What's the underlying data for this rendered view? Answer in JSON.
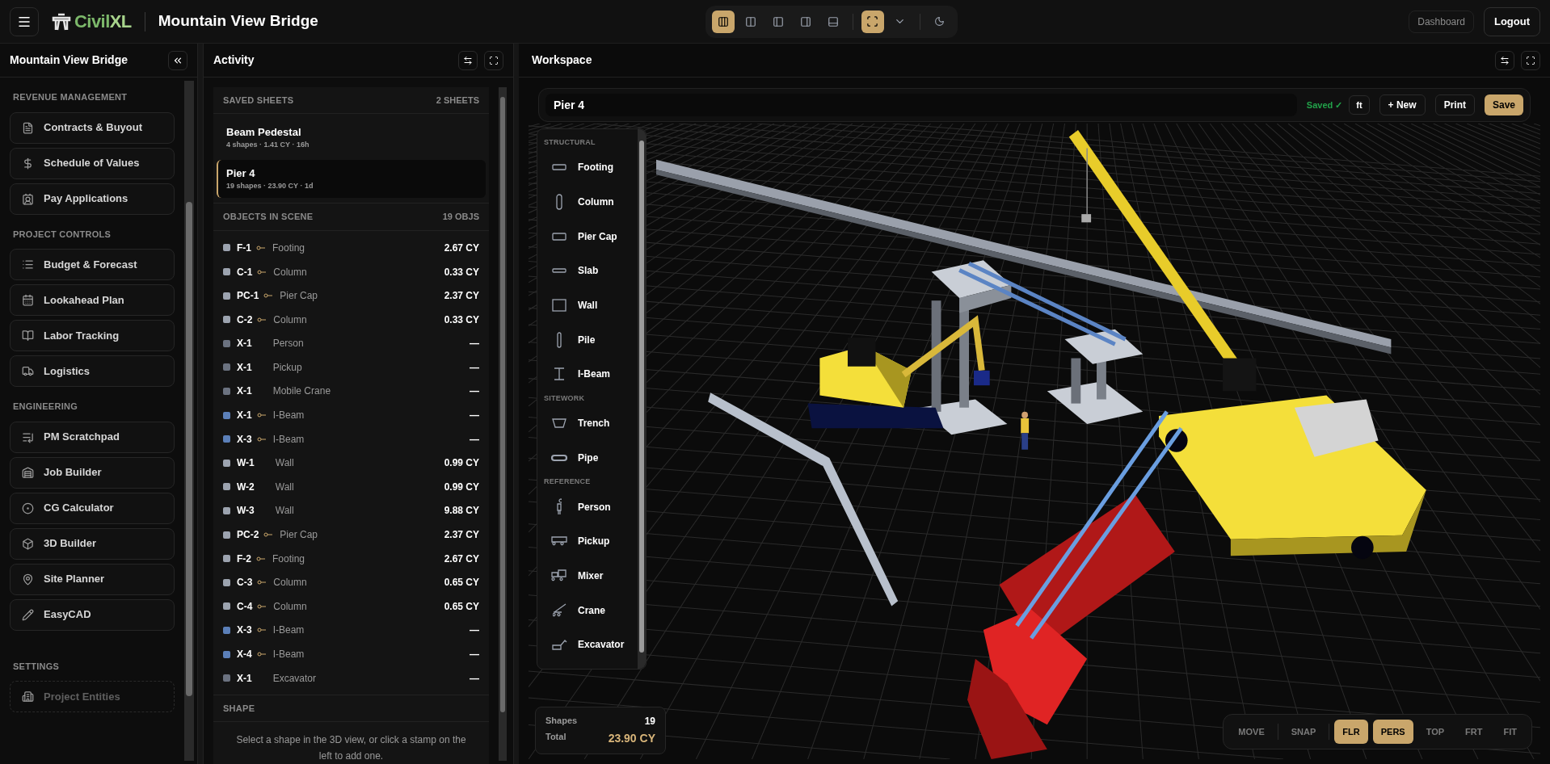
{
  "header": {
    "project_title": "Mountain View Bridge",
    "logo": {
      "prefix": "Civil",
      "suffix": "XL"
    },
    "view_buttons": [
      {
        "selected": true
      },
      {
        "selected": false
      },
      {
        "selected": false
      },
      {
        "selected": false
      },
      {
        "selected": false
      }
    ],
    "fullscreen": {
      "selected": true
    },
    "actions": [
      {
        "label": "Dashboard",
        "kind": "ghost"
      },
      {
        "label": "Logout",
        "kind": "outline"
      }
    ]
  },
  "sidebar": {
    "title": "Mountain View Bridge",
    "sections": [
      {
        "label": "REVENUE MANAGEMENT",
        "items": [
          {
            "label": "Contracts & Buyout",
            "disabled": false
          },
          {
            "label": "Schedule of Values",
            "disabled": false
          },
          {
            "label": "Pay Applications",
            "disabled": false
          }
        ]
      },
      {
        "label": "PROJECT CONTROLS",
        "items": [
          {
            "label": "Budget & Forecast",
            "disabled": false
          },
          {
            "label": "Lookahead Plan",
            "disabled": false
          },
          {
            "label": "Labor Tracking",
            "disabled": false
          },
          {
            "label": "Logistics",
            "disabled": false
          }
        ]
      },
      {
        "label": "ENGINEERING",
        "items": [
          {
            "label": "PM Scratchpad",
            "disabled": false
          },
          {
            "label": "Job Builder",
            "disabled": false
          },
          {
            "label": "CG Calculator",
            "disabled": false
          },
          {
            "label": "3D Builder",
            "disabled": false
          },
          {
            "label": "Site Planner",
            "disabled": false
          },
          {
            "label": "EasyCAD",
            "disabled": false
          }
        ]
      },
      {
        "label": "SETTINGS",
        "items": [
          {
            "label": "Project Entities",
            "disabled": true
          }
        ]
      }
    ]
  },
  "activity": {
    "title": "Activity",
    "saved_sheets": {
      "label": "SAVED SHEETS",
      "count": "2 SHEETS",
      "sheets": [
        {
          "name": "Beam Pedestal",
          "meta": "4 shapes · 1.41 CY · 16h",
          "selected": false
        },
        {
          "name": "Pier 4",
          "meta": "19 shapes · 23.90 CY · 1d",
          "selected": true
        }
      ]
    },
    "objects": {
      "label": "OBJECTS IN SCENE",
      "count": "19 OBJS",
      "rows": [
        {
          "id": "F-1",
          "linked": true,
          "type": "Footing",
          "volume": "2.67 CY",
          "color": "#9ca3af"
        },
        {
          "id": "C-1",
          "linked": true,
          "type": "Column",
          "volume": "0.33 CY",
          "color": "#9ca3af"
        },
        {
          "id": "PC-1",
          "linked": true,
          "type": "Pier Cap",
          "volume": "2.37 CY",
          "color": "#9ca3af"
        },
        {
          "id": "C-2",
          "linked": true,
          "type": "Column",
          "volume": "0.33 CY",
          "color": "#9ca3af"
        },
        {
          "id": "X-1",
          "linked": false,
          "type": "Person",
          "volume": "—",
          "color": "#6b7280"
        },
        {
          "id": "X-1",
          "linked": false,
          "type": "Pickup",
          "volume": "—",
          "color": "#6b7280"
        },
        {
          "id": "X-1",
          "linked": false,
          "type": "Mobile Crane",
          "volume": "—",
          "color": "#6b7280"
        },
        {
          "id": "X-1",
          "linked": true,
          "type": "I-Beam",
          "volume": "—",
          "color": "#5b7fb8"
        },
        {
          "id": "X-3",
          "linked": true,
          "type": "I-Beam",
          "volume": "—",
          "color": "#5b7fb8"
        },
        {
          "id": "W-1",
          "linked": false,
          "type": "Wall",
          "volume": "0.99 CY",
          "color": "#9ca3af"
        },
        {
          "id": "W-2",
          "linked": false,
          "type": "Wall",
          "volume": "0.99 CY",
          "color": "#9ca3af"
        },
        {
          "id": "W-3",
          "linked": false,
          "type": "Wall",
          "volume": "9.88 CY",
          "color": "#9ca3af"
        },
        {
          "id": "PC-2",
          "linked": true,
          "type": "Pier Cap",
          "volume": "2.37 CY",
          "color": "#9ca3af"
        },
        {
          "id": "F-2",
          "linked": true,
          "type": "Footing",
          "volume": "2.67 CY",
          "color": "#9ca3af"
        },
        {
          "id": "C-3",
          "linked": true,
          "type": "Column",
          "volume": "0.65 CY",
          "color": "#9ca3af"
        },
        {
          "id": "C-4",
          "linked": true,
          "type": "Column",
          "volume": "0.65 CY",
          "color": "#9ca3af"
        },
        {
          "id": "X-3",
          "linked": true,
          "type": "I-Beam",
          "volume": "—",
          "color": "#5b7fb8"
        },
        {
          "id": "X-4",
          "linked": true,
          "type": "I-Beam",
          "volume": "—",
          "color": "#5b7fb8"
        },
        {
          "id": "X-1",
          "linked": false,
          "type": "Excavator",
          "volume": "—",
          "color": "#6b7280"
        }
      ]
    },
    "shape": {
      "label": "SHAPE",
      "hint": "Select a shape in the 3D view, or click a stamp on the left to add one."
    }
  },
  "workspace": {
    "title": "Workspace",
    "toolbar": {
      "sheet_name": "Pier 4",
      "status": "Saved ✓",
      "unit": "ft",
      "buttons": [
        {
          "label": "+ New",
          "kind": "outline"
        },
        {
          "label": "Print",
          "kind": "outline"
        },
        {
          "label": "Save",
          "kind": "primary"
        }
      ]
    },
    "palette": {
      "groups": [
        {
          "label": "STRUCTURAL",
          "items": [
            "Footing",
            "Column",
            "Pier Cap",
            "Slab",
            "Wall",
            "Pile",
            "I-Beam"
          ]
        },
        {
          "label": "SITEWORK",
          "items": [
            "Trench",
            "Pipe"
          ]
        },
        {
          "label": "REFERENCE",
          "items": [
            "Person",
            "Pickup",
            "Mixer",
            "Crane",
            "Excavator"
          ]
        }
      ]
    },
    "totals": {
      "shapes_label": "Shapes",
      "shapes": "19",
      "total_label": "Total",
      "total": "23.90 CY"
    },
    "camera_buttons": [
      {
        "label": "MOVE",
        "selected": false
      },
      {
        "label": "SNAP",
        "selected": false
      },
      {
        "label": "FLR",
        "selected": true
      },
      {
        "label": "PERS",
        "selected": true
      },
      {
        "label": "TOP",
        "selected": false
      },
      {
        "label": "FRT",
        "selected": false
      },
      {
        "label": "FIT",
        "selected": false
      }
    ]
  }
}
